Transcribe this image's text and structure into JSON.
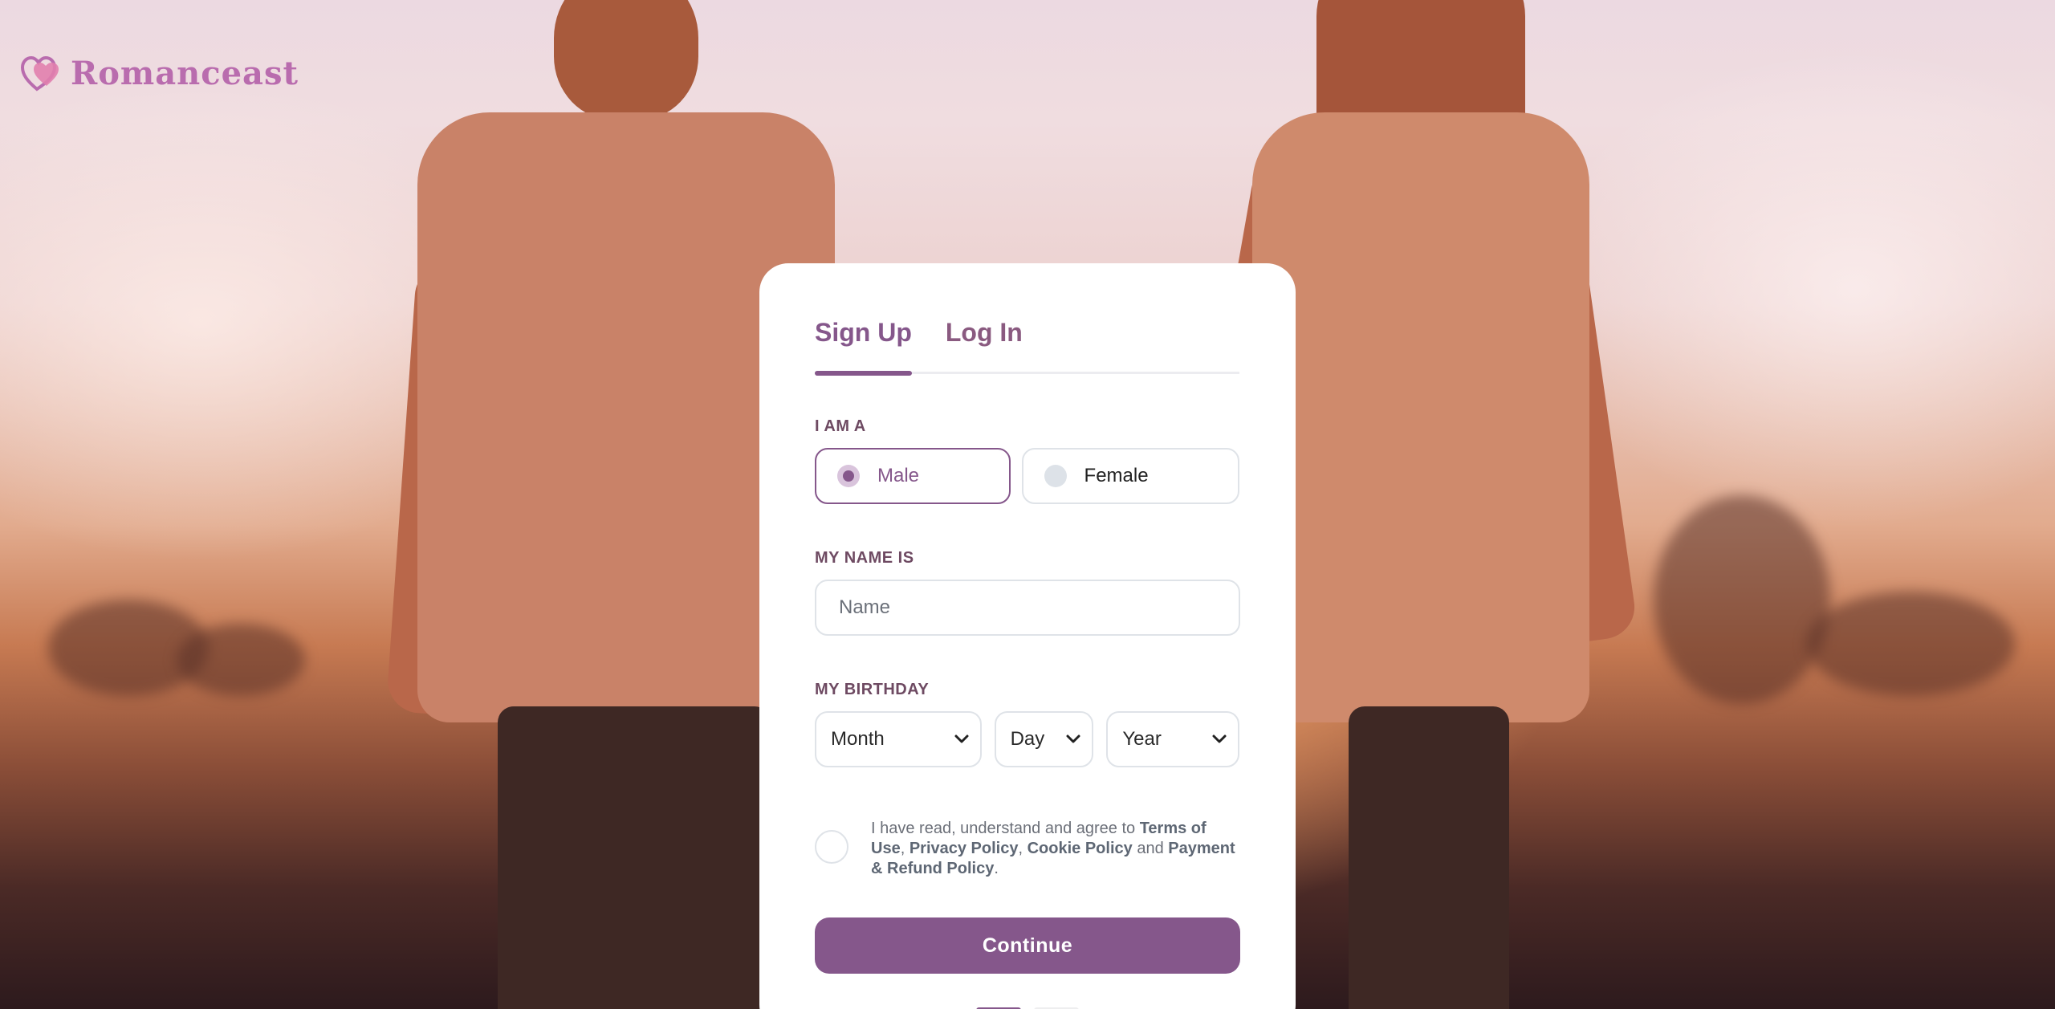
{
  "brand": {
    "name": "Romanceast",
    "accent": "#85578b",
    "logo_color": "#b96cae"
  },
  "tabs": [
    {
      "label": "Sign Up",
      "active": true
    },
    {
      "label": "Log In",
      "active": false
    }
  ],
  "form": {
    "gender": {
      "label": "I AM A",
      "options": [
        {
          "label": "Male",
          "selected": true
        },
        {
          "label": "Female",
          "selected": false
        }
      ]
    },
    "name": {
      "label": "MY NAME IS",
      "placeholder": "Name",
      "value": ""
    },
    "birthday": {
      "label": "MY BIRTHDAY",
      "month": "Month",
      "day": "Day",
      "year": "Year"
    },
    "agreement": {
      "checked": false,
      "prefix": "I have read, understand and agree to ",
      "terms": "Terms of Use",
      "sep1": ", ",
      "privacy": "Privacy Policy",
      "sep2": ", ",
      "cookie": "Cookie Policy",
      "sep3": " and ",
      "payment": "Payment & Refund Policy",
      "suffix": "."
    },
    "continue_label": "Continue"
  },
  "steps": {
    "current": 1,
    "total": 2
  },
  "icons": {
    "logo": "double-heart-icon",
    "select": "chevron-down-icon"
  }
}
